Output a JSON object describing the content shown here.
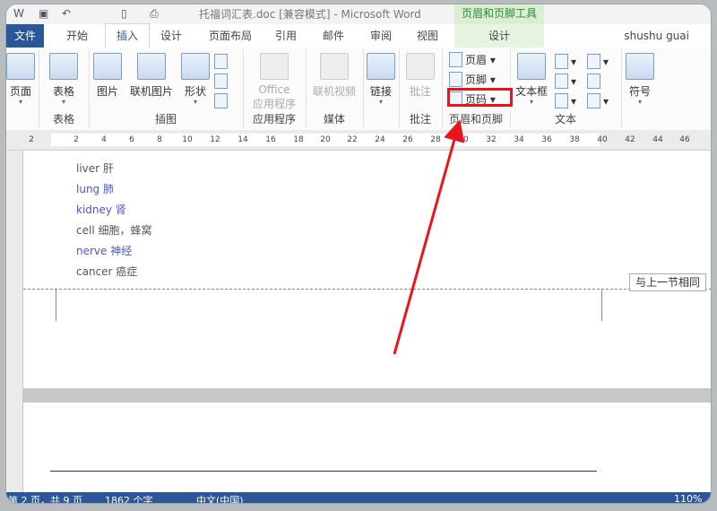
{
  "titlebar": {
    "title": "托福词汇表.doc [兼容模式] - Microsoft Word",
    "contextual": "页眉和页脚工具"
  },
  "tabs": [
    "文件",
    "开始",
    "插入",
    "设计",
    "页面布局",
    "引用",
    "邮件",
    "审阅",
    "视图",
    "设计"
  ],
  "active_tab": "插入",
  "user": "shushu guai",
  "ribbon": {
    "page_btn": "页面",
    "table_btn": "表格",
    "table_group": "表格",
    "picture_btn": "图片",
    "online_picture_btn": "联机图片",
    "shapes_btn": "形状",
    "illustrations_group": "插图",
    "office_apps_btn_1": "Office",
    "office_apps_btn_2": "应用程序",
    "apps_group": "应用程序",
    "online_video_btn": "联机视频",
    "media_group": "媒体",
    "link_btn": "链接",
    "comment_btn": "批注",
    "comments_group": "批注",
    "header_btn": "页眉",
    "footer_btn": "页脚",
    "page_number_btn": "页码",
    "header_footer_group": "页眉和页脚",
    "textbox_btn": "文本框",
    "text_group": "文本",
    "symbol_btn": "符号"
  },
  "ruler_ticks": [
    "2",
    "2",
    "4",
    "6",
    "8",
    "10",
    "12",
    "14",
    "16",
    "18",
    "20",
    "22",
    "24",
    "26",
    "28",
    "30",
    "32",
    "34",
    "36",
    "38",
    "40",
    "42",
    "44",
    "46"
  ],
  "document": {
    "lines": [
      {
        "text": "liver 肝",
        "style": "gray"
      },
      {
        "text": "lung 肺",
        "style": "blue"
      },
      {
        "text": "kidney 肾",
        "style": "blue"
      },
      {
        "text": "cell 细胞，蜂窝",
        "style": "gray"
      },
      {
        "text": "nerve 神经",
        "style": "blue"
      },
      {
        "text": "cancer 癌症",
        "style": "gray"
      }
    ],
    "same_as_previous": "与上一节相同"
  },
  "statusbar": {
    "page": "第 2 页，共 9 页",
    "words": "1862 个字",
    "language": "中文(中国)",
    "zoom": "110%"
  }
}
